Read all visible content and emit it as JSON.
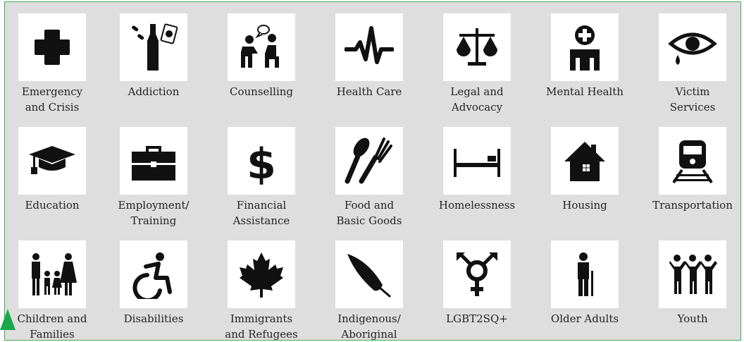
{
  "colors": {
    "panel_bg": "#dedede",
    "border": "#3cae55",
    "icon": "#111111",
    "arrow": "#1aa84a"
  },
  "tiles": [
    {
      "label": "Emergency\nand Crisis",
      "icon": "plus-icon"
    },
    {
      "label": "Addiction",
      "icon": "bottle-pills-cards-icon"
    },
    {
      "label": "Counselling",
      "icon": "counselling-icon"
    },
    {
      "label": "Health Care",
      "icon": "heartbeat-icon"
    },
    {
      "label": "Legal and\nAdvocacy",
      "icon": "scales-icon"
    },
    {
      "label": "Mental Health",
      "icon": "mental-health-icon"
    },
    {
      "label": "Victim\nServices",
      "icon": "crying-eye-icon"
    },
    {
      "label": "Education",
      "icon": "graduation-cap-icon"
    },
    {
      "label": "Employment/\nTraining",
      "icon": "briefcase-icon"
    },
    {
      "label": "Financial\nAssistance",
      "icon": "dollar-icon"
    },
    {
      "label": "Food and\nBasic Goods",
      "icon": "fork-spoon-icon"
    },
    {
      "label": "Homelessness",
      "icon": "bed-icon"
    },
    {
      "label": "Housing",
      "icon": "house-icon"
    },
    {
      "label": "Transportation",
      "icon": "train-icon"
    },
    {
      "label": "Children and\nFamilies",
      "icon": "family-icon"
    },
    {
      "label": "Disabilities",
      "icon": "wheelchair-icon"
    },
    {
      "label": "Immigrants\nand Refugees",
      "icon": "maple-leaf-icon"
    },
    {
      "label": "Indigenous/\nAboriginal",
      "icon": "feather-icon"
    },
    {
      "label": "LGBT2SQ+",
      "icon": "transgender-symbol-icon"
    },
    {
      "label": "Older Adults",
      "icon": "elderly-person-icon"
    },
    {
      "label": "Youth",
      "icon": "youth-group-icon"
    }
  ]
}
